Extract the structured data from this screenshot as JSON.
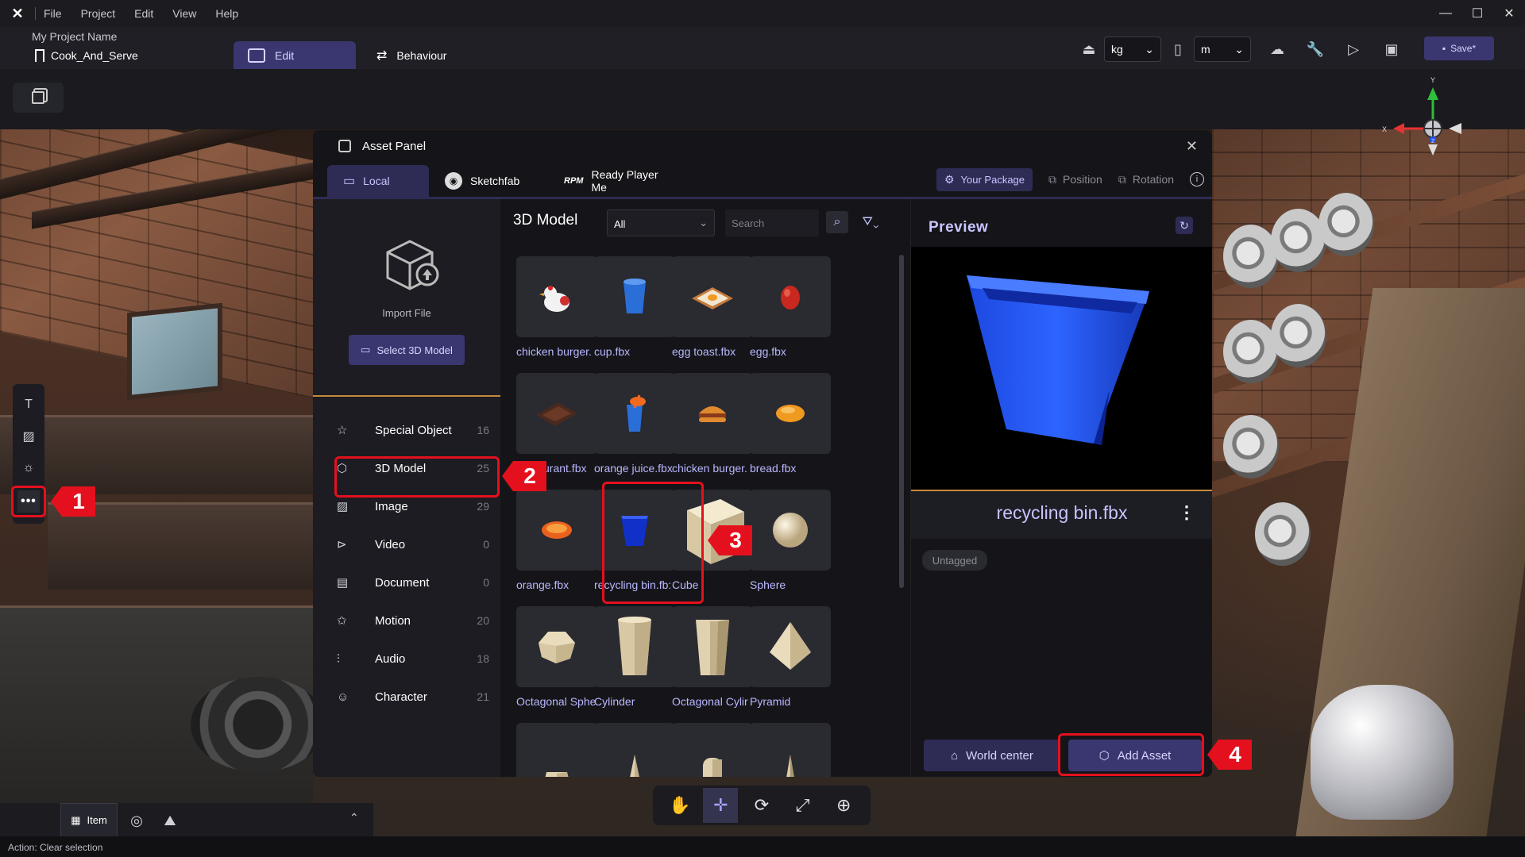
{
  "app": {
    "menu": [
      "File",
      "Project",
      "Edit",
      "View",
      "Help"
    ],
    "project_name": "My Project Name",
    "scene_name": "Cook_And_Serve",
    "mode_tabs": [
      "Edit",
      "Behaviour"
    ],
    "mass_unit": "kg",
    "length_unit": "m",
    "save_label": "Save*"
  },
  "asset_panel": {
    "title": "Asset Panel",
    "source_tabs": [
      "Local",
      "Sketchfab",
      "Ready Player Me"
    ],
    "active_source": "Local",
    "right_tools": [
      "Your Package",
      "Position",
      "Rotation"
    ],
    "import": {
      "label": "Import File",
      "button": "Select 3D Model"
    },
    "categories": [
      {
        "icon": "star-icon",
        "label": "Special Object",
        "count": "16"
      },
      {
        "icon": "cube-icon",
        "label": "3D Model",
        "count": "25"
      },
      {
        "icon": "image-icon",
        "label": "Image",
        "count": "29"
      },
      {
        "icon": "video-icon",
        "label": "Video",
        "count": "0"
      },
      {
        "icon": "document-icon",
        "label": "Document",
        "count": "0"
      },
      {
        "icon": "motion-icon",
        "label": "Motion",
        "count": "20"
      },
      {
        "icon": "audio-icon",
        "label": "Audio",
        "count": "18"
      },
      {
        "icon": "character-icon",
        "label": "Character",
        "count": "21"
      }
    ],
    "grid": {
      "title": "3D Model",
      "type_filter": "All",
      "search_placeholder": "Search",
      "items": [
        {
          "label": "chicken burger.",
          "thumb": "chicken"
        },
        {
          "label": "cup.fbx",
          "thumb": "cup"
        },
        {
          "label": "egg toast.fbx",
          "thumb": "toast"
        },
        {
          "label": "egg.fbx",
          "thumb": "egg"
        },
        {
          "label": "urant.fbx",
          "thumb": "tray"
        },
        {
          "label": "orange juice.fbx",
          "thumb": "juice"
        },
        {
          "label": "chicken burger.",
          "thumb": "burger"
        },
        {
          "label": "bread.fbx",
          "thumb": "bread"
        },
        {
          "label": "orange.fbx",
          "thumb": "orange"
        },
        {
          "label": "recycling bin.fb:",
          "thumb": "bin"
        },
        {
          "label": "Cube",
          "thumb": "cube"
        },
        {
          "label": "Sphere",
          "thumb": "sphere"
        },
        {
          "label": "Octagonal Sphe",
          "thumb": "octasphere"
        },
        {
          "label": "Cylinder",
          "thumb": "cylinder"
        },
        {
          "label": "Octagonal Cylir",
          "thumb": "octacyl"
        },
        {
          "label": "Pyramid",
          "thumb": "pyramid"
        },
        {
          "label": "",
          "thumb": "frustum"
        },
        {
          "label": "",
          "thumb": "cone"
        },
        {
          "label": "",
          "thumb": "capsule"
        },
        {
          "label": "",
          "thumb": "spike"
        }
      ]
    },
    "preview": {
      "title": "Preview",
      "asset_name": "recycling bin.fbx",
      "tag": "Untagged",
      "world_center": "World center",
      "add_asset": "Add Asset"
    }
  },
  "bottom": {
    "item_tab": "Item",
    "status": "Action: Clear selection"
  },
  "gizmo": {
    "y": "Y",
    "x": "X",
    "z": "Z"
  },
  "annotations": [
    "1",
    "2",
    "3",
    "4"
  ],
  "colors": {
    "accent": "#3a3770",
    "highlight": "#e5101d",
    "label": "#b9b7ff"
  }
}
